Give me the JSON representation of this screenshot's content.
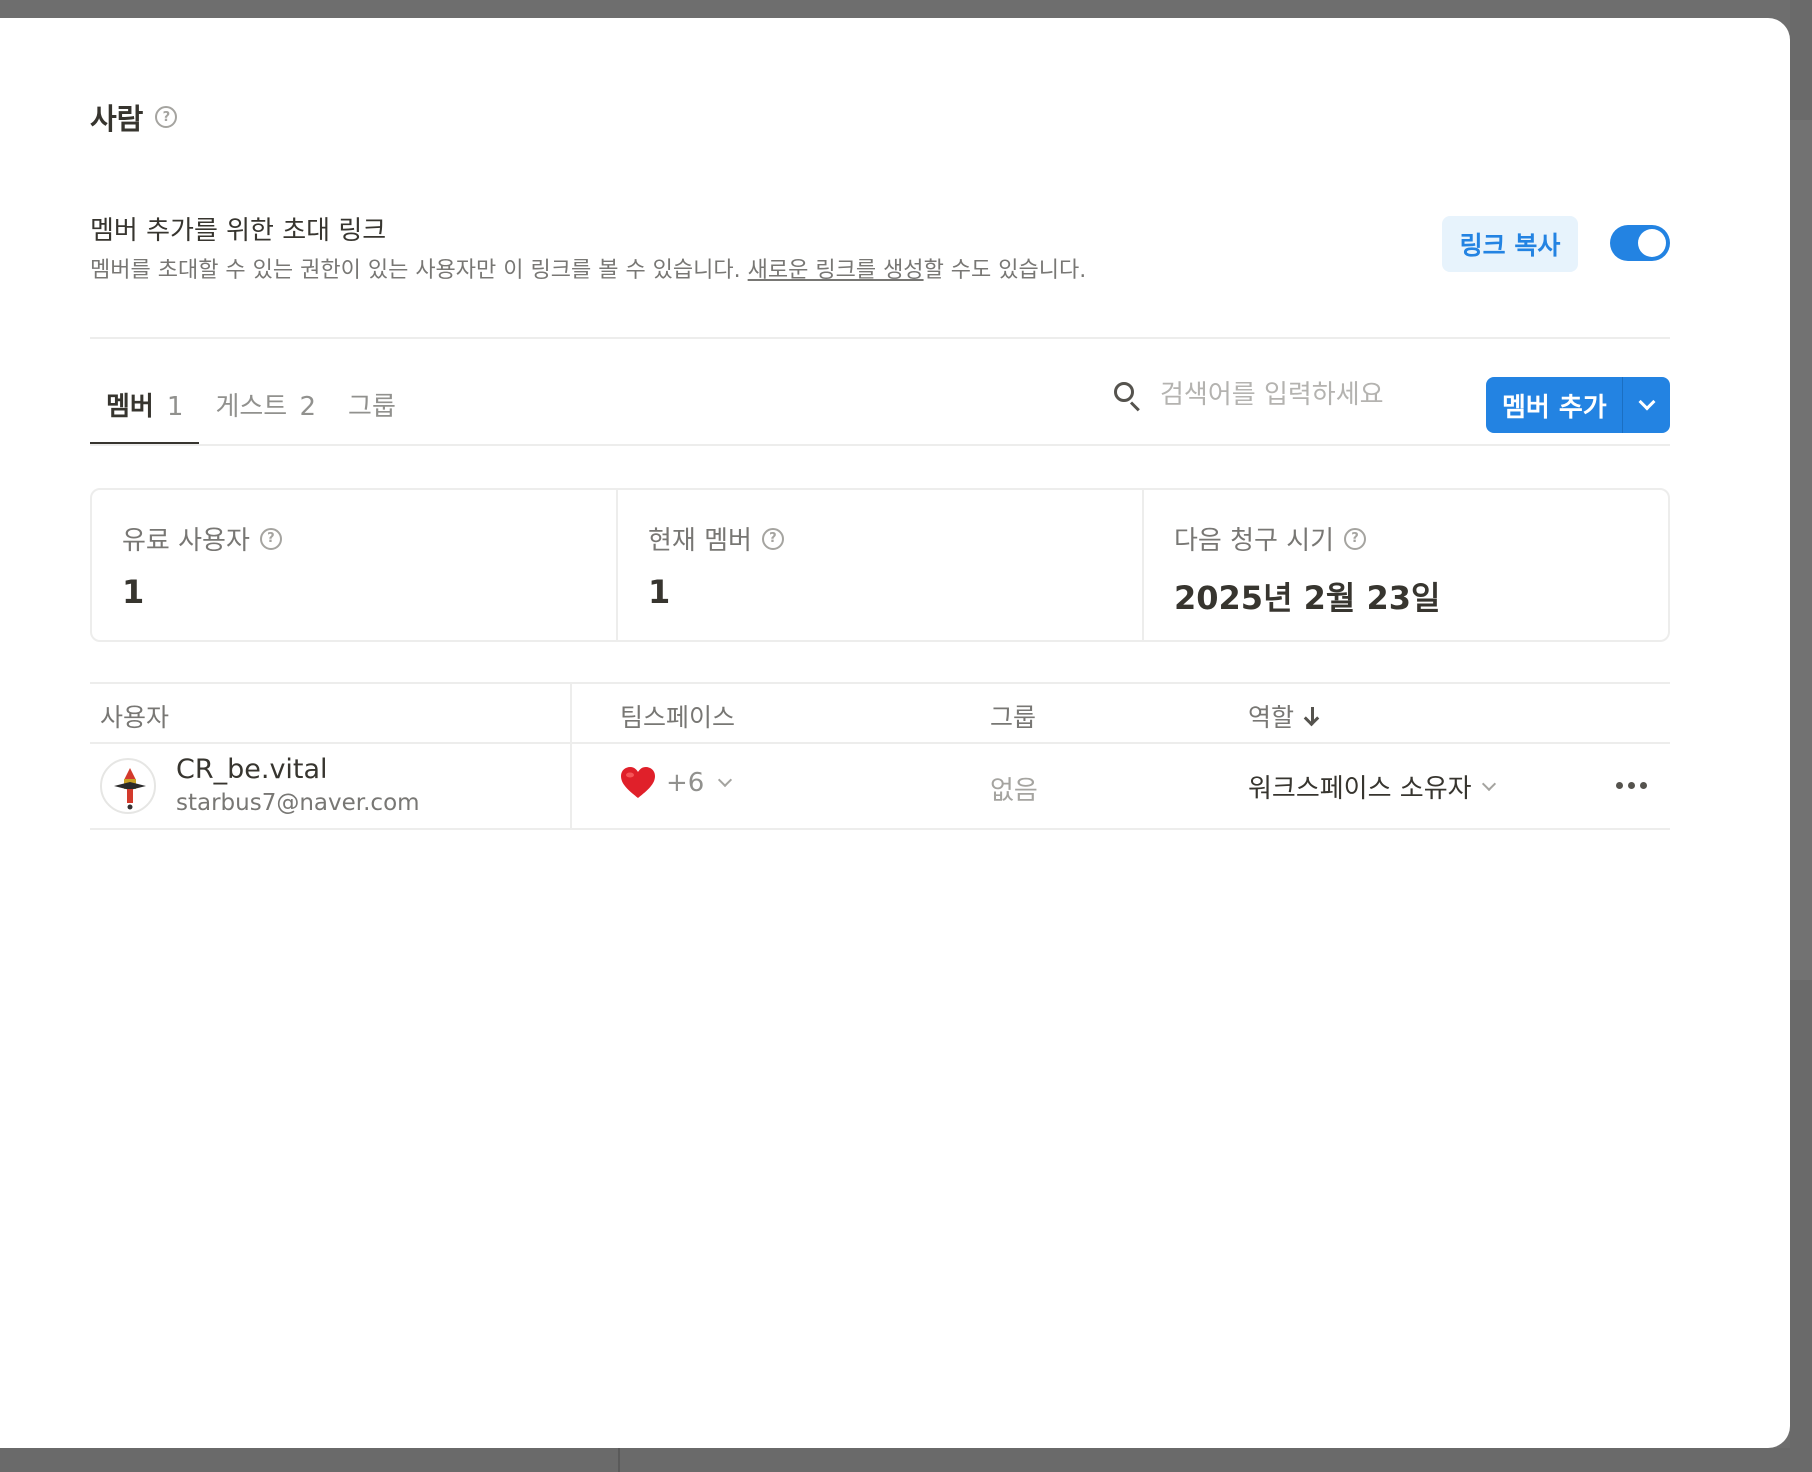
{
  "page": {
    "title": "사람"
  },
  "invite": {
    "title": "멤버 추가를 위한 초대 링크",
    "desc_prefix": "멤버를 초대할 수 있는 권한이 있는 사용자만 이 링크를 볼 수 있습니다. ",
    "desc_link": "새로운 링크를 생성",
    "desc_suffix": "할 수도 있습니다.",
    "copy_link_label": "링크 복사",
    "toggle_on": true
  },
  "tabs": [
    {
      "label": "멤버",
      "count": "1",
      "active": true
    },
    {
      "label": "게스트",
      "count": "2",
      "active": false
    },
    {
      "label": "그룹",
      "count": "",
      "active": false
    }
  ],
  "search": {
    "placeholder": "검색어를 입력하세요"
  },
  "add_member": {
    "label": "멤버 추가"
  },
  "stats": [
    {
      "label": "유료 사용자",
      "value": "1"
    },
    {
      "label": "현재 멤버",
      "value": "1"
    },
    {
      "label": "다음 청구 시기",
      "value": "2025년 2월 23일"
    }
  ],
  "table": {
    "headers": {
      "user": "사용자",
      "teamspace": "팀스페이스",
      "group": "그룹",
      "role": "역할"
    },
    "rows": [
      {
        "name": "CR_be.vital",
        "email": "starbus7@naver.com",
        "teamspace_extra": "+6",
        "group": "없음",
        "role": "워크스페이스 소유자"
      }
    ]
  },
  "colors": {
    "accent": "#2383e2",
    "accent_light": "#e7f3fc",
    "text": "#37352f",
    "muted": "#787774"
  }
}
